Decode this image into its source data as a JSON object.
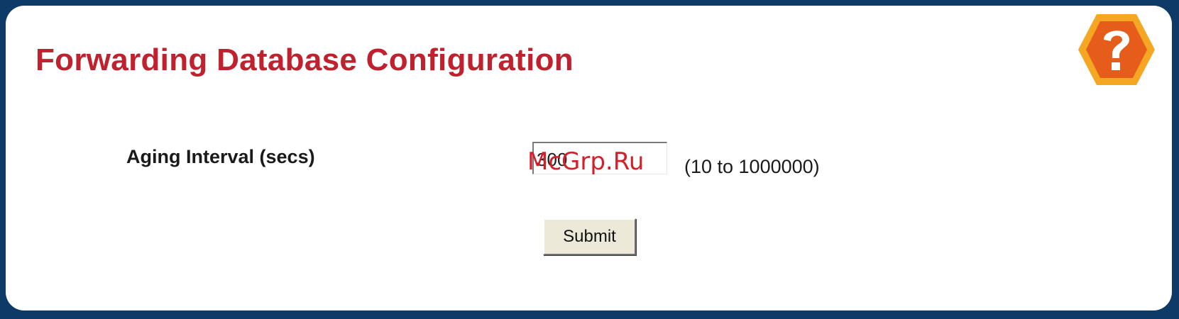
{
  "page": {
    "title": "Forwarding Database Configuration",
    "help_icon": "help-question-icon"
  },
  "form": {
    "aging_interval": {
      "label": "Aging Interval (secs)",
      "value": "300",
      "range_hint": "(10 to 1000000)"
    },
    "submit_label": "Submit"
  },
  "watermark": "McGrp.Ru",
  "colors": {
    "frame_background": "#0d3a66",
    "title": "#c0212e",
    "help_icon_outer": "#f5a623",
    "help_icon_inner": "#e65c1a",
    "watermark": "#d21f2a"
  }
}
